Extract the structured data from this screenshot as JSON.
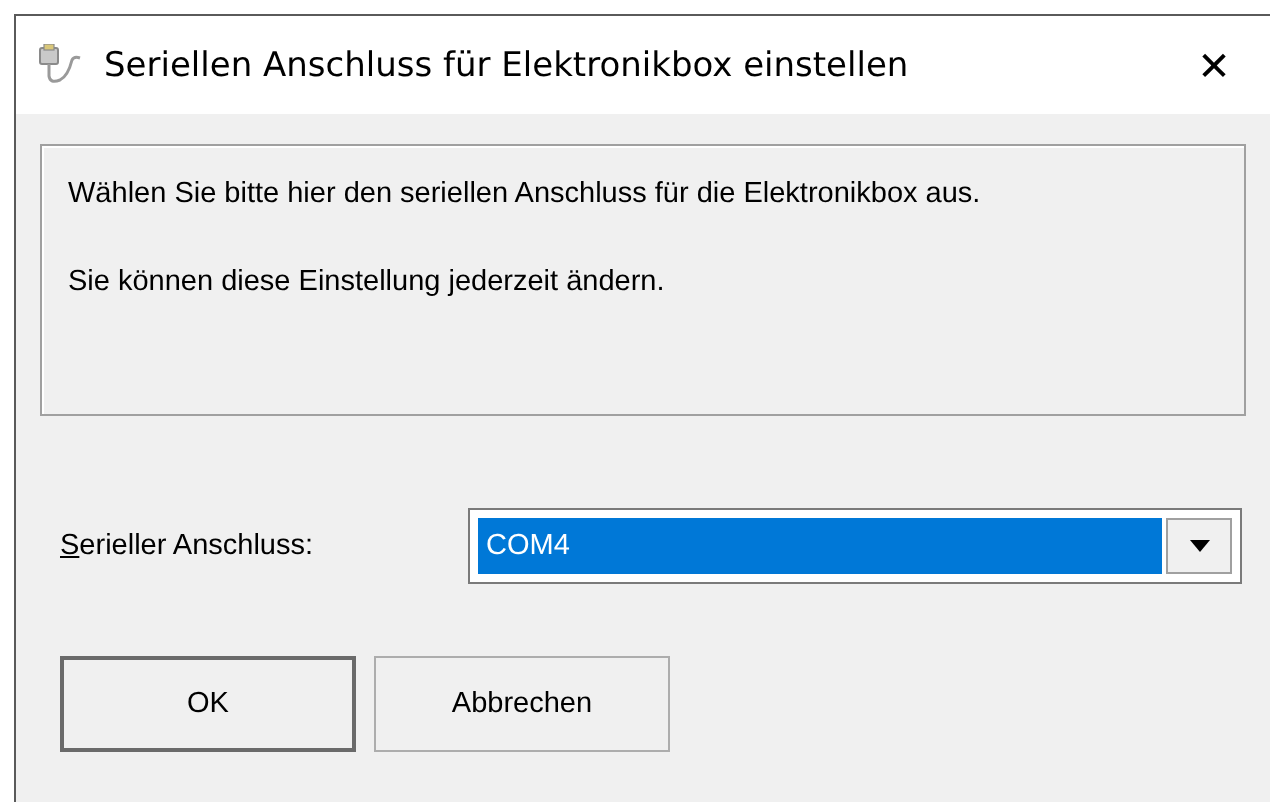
{
  "window": {
    "title": "Seriellen Anschluss für Elektronikbox einstellen",
    "close": "✕"
  },
  "info": {
    "paragraphs": [
      "Wählen Sie bitte hier den seriellen Anschluss für die Elektronikbox aus.",
      "Sie können diese Einstellung jederzeit ändern."
    ]
  },
  "port": {
    "label": "Serieller Anschluss:",
    "value": "COM4",
    "focused": true
  },
  "buttons": [
    {
      "label": "OK",
      "default": true
    },
    {
      "label": "Abbrechen",
      "default": false
    }
  ]
}
